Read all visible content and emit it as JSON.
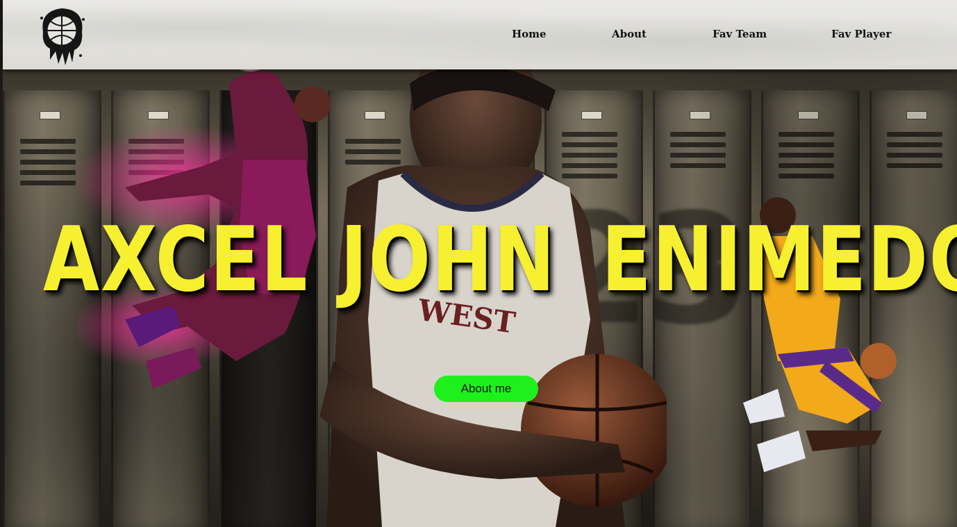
{
  "header": {
    "logo_icon": "street-ball-logo-icon",
    "nav": [
      {
        "label": "Home"
      },
      {
        "label": "About"
      },
      {
        "label": "Fav Team"
      },
      {
        "label": "Fav Player"
      }
    ]
  },
  "hero": {
    "name_words": [
      "AXCEL",
      "JOHN",
      "ENIMEDO"
    ],
    "graffiti_number": "23",
    "jersey_text": "WEST",
    "cta_label": "About me",
    "colors": {
      "title": "#f6f030",
      "cta_bg": "#1ef01e"
    }
  }
}
